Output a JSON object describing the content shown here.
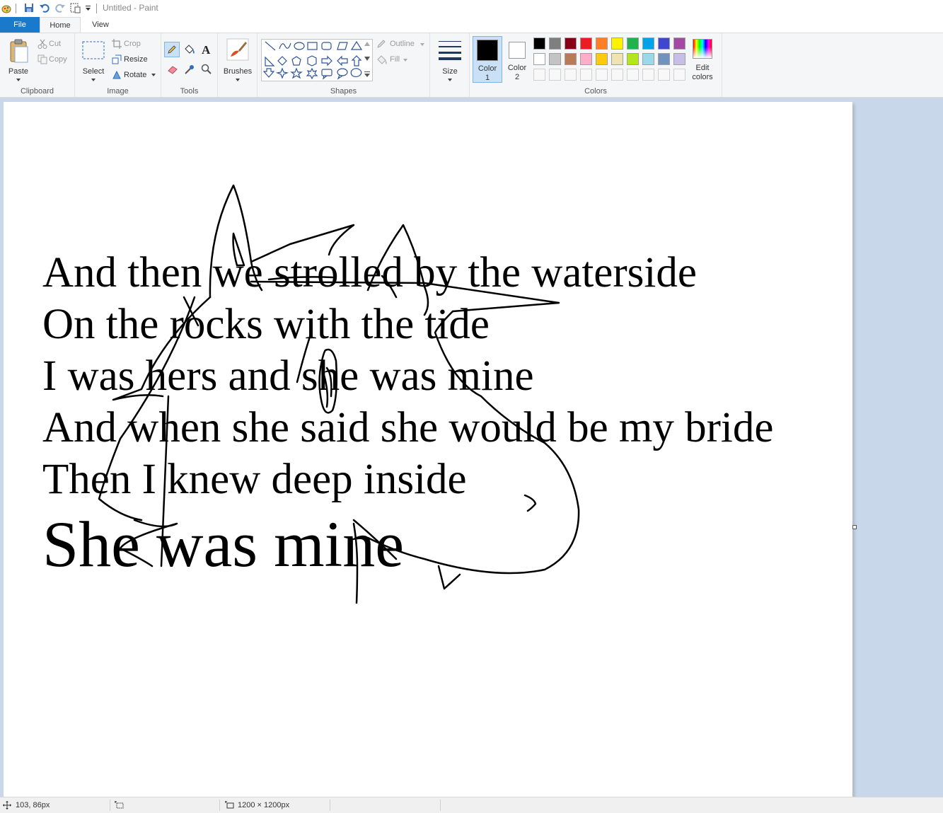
{
  "window": {
    "title": "Untitled - Paint"
  },
  "tabs": {
    "file": "File",
    "home": "Home",
    "view": "View"
  },
  "ribbon": {
    "clipboard": {
      "paste": "Paste",
      "cut": "Cut",
      "copy": "Copy",
      "label": "Clipboard"
    },
    "image": {
      "select": "Select",
      "crop": "Crop",
      "resize": "Resize",
      "rotate": "Rotate",
      "label": "Image"
    },
    "tools": {
      "label": "Tools"
    },
    "brushes": {
      "label": "Brushes"
    },
    "shapes": {
      "outline": "Outline",
      "fill": "Fill",
      "label": "Shapes"
    },
    "size": {
      "label": "Size"
    },
    "colors": {
      "color1": "Color",
      "color1_num": "1",
      "color2": "Color",
      "color2_num": "2",
      "edit_line1": "Edit",
      "edit_line2": "colors",
      "label": "Colors",
      "color1_value": "#000000",
      "color2_value": "#ffffff",
      "palette_row1": [
        "#000000",
        "#7f7f7f",
        "#880015",
        "#ed1c24",
        "#ff7f27",
        "#fff200",
        "#22b14c",
        "#00a2e8",
        "#3f48cc",
        "#a349a4"
      ],
      "palette_row2": [
        "#ffffff",
        "#c3c3c3",
        "#b97a57",
        "#ffaec9",
        "#ffc90e",
        "#efe4b0",
        "#b5e61d",
        "#99d9ea",
        "#7092be",
        "#c8bfe7"
      ]
    }
  },
  "canvas": {
    "lines": [
      "And then we strolled by the waterside",
      "On the rocks with the tide",
      "I was hers and she was mine",
      "And when she said she would be my bride",
      "Then I knew deep inside",
      "She was mine"
    ]
  },
  "status": {
    "cursor_pos": "103, 86px",
    "canvas_size": "1200 × 1200px"
  }
}
